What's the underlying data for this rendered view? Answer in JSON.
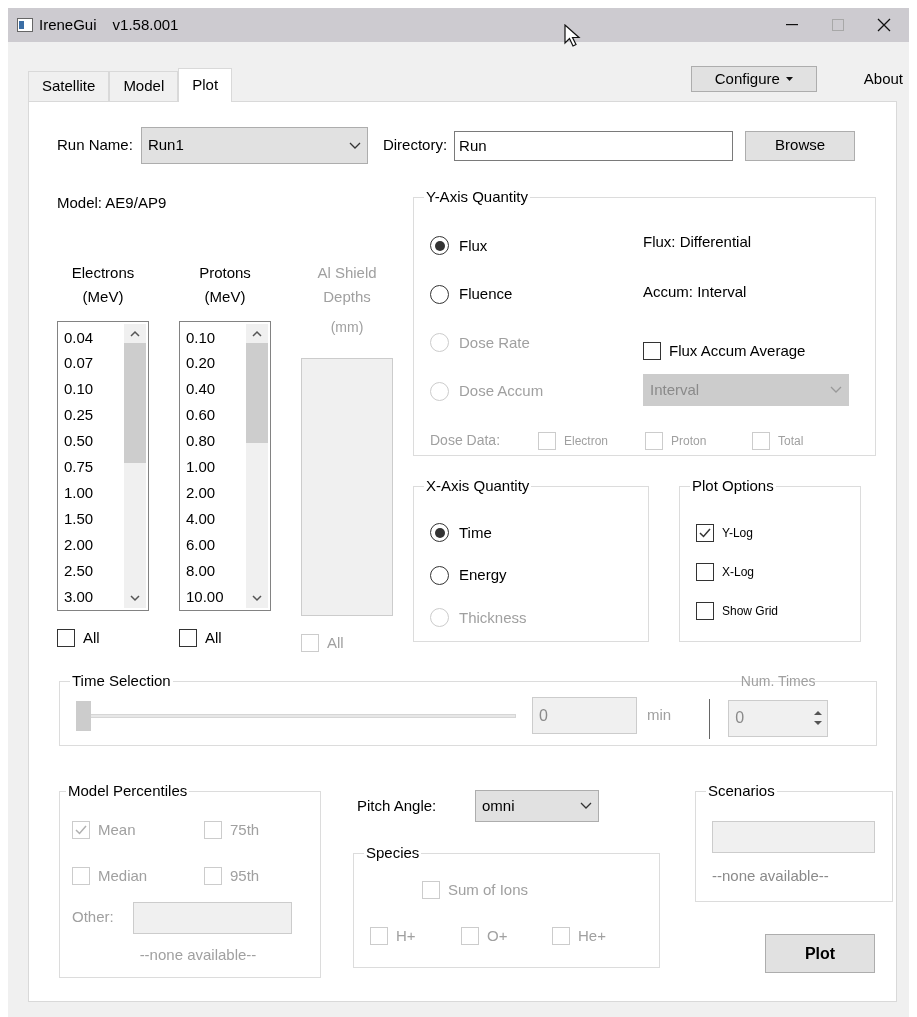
{
  "window": {
    "title": "IreneGui",
    "version": "v1.58.001"
  },
  "tabs": [
    {
      "label": "Satellite",
      "selected": false
    },
    {
      "label": "Model",
      "selected": false
    },
    {
      "label": "Plot",
      "selected": true
    }
  ],
  "toolbar": {
    "configure": "Configure",
    "about": "About"
  },
  "run_name": {
    "label": "Run Name:",
    "value": "Run1"
  },
  "directory": {
    "label": "Directory:",
    "value": "Run"
  },
  "browse": "Browse",
  "model_label": "Model: AE9/AP9",
  "energy_lists": [
    {
      "heading": [
        "Electrons",
        "(MeV)"
      ],
      "disabled": false,
      "items": [
        "0.04",
        "0.07",
        "0.10",
        "0.25",
        "0.50",
        "0.75",
        "1.00",
        "1.50",
        "2.00",
        "2.50",
        "3.00"
      ],
      "all": {
        "label": "All",
        "checked": false
      }
    },
    {
      "heading": [
        "Protons",
        "(MeV)"
      ],
      "disabled": false,
      "items": [
        "0.10",
        "0.20",
        "0.40",
        "0.60",
        "0.80",
        "1.00",
        "2.00",
        "4.00",
        "6.00",
        "8.00",
        "10.00"
      ],
      "all": {
        "label": "All",
        "checked": false
      }
    },
    {
      "heading": [
        "Al Shield",
        "Depths"
      ],
      "unit": "(mm)",
      "disabled": true,
      "all": {
        "label": "All",
        "checked": false
      }
    }
  ],
  "y_axis": {
    "title": "Y-Axis Quantity",
    "options": [
      {
        "label": "Flux",
        "selected": true,
        "disabled": false
      },
      {
        "label": "Fluence",
        "selected": false,
        "disabled": false
      },
      {
        "label": "Dose Rate",
        "selected": false,
        "disabled": true
      },
      {
        "label": "Dose Accum",
        "selected": false,
        "disabled": true
      }
    ],
    "flux_info": "Flux: Differential",
    "accum_info": "Accum: Interval",
    "average": {
      "label": "Flux Accum Average",
      "checked": false
    },
    "average_select": {
      "value": "Interval",
      "disabled": true
    },
    "dose_data": {
      "label": "Dose Data:",
      "disabled": true,
      "items": [
        {
          "label": "Electron",
          "checked": false
        },
        {
          "label": "Proton",
          "checked": false
        },
        {
          "label": "Total",
          "checked": false
        }
      ]
    }
  },
  "x_axis": {
    "title": "X-Axis Quantity",
    "options": [
      {
        "label": "Time",
        "selected": true,
        "disabled": false
      },
      {
        "label": "Energy",
        "selected": false,
        "disabled": false
      },
      {
        "label": "Thickness",
        "selected": false,
        "disabled": true
      }
    ]
  },
  "plot_options": {
    "title": "Plot Options",
    "items": [
      {
        "label": "Y-Log",
        "checked": true
      },
      {
        "label": "X-Log",
        "checked": false
      },
      {
        "label": "Show Grid",
        "checked": false
      }
    ]
  },
  "time_selection": {
    "title": "Time Selection",
    "disabled": true,
    "level": 0,
    "value": "0",
    "unit": "min",
    "num_times_label": "Num. Times",
    "num_times": "0"
  },
  "model_percentiles": {
    "title": "Model Percentiles",
    "disabled": true,
    "options": [
      {
        "label": "Mean",
        "checked": true
      },
      {
        "label": "75th",
        "checked": false
      },
      {
        "label": "Median",
        "checked": false
      },
      {
        "label": "95th",
        "checked": false
      }
    ],
    "other_label": "Other:",
    "note": "--none available--"
  },
  "pitch_angle": {
    "label": "Pitch Angle:",
    "value": "omni"
  },
  "species": {
    "title": "Species",
    "disabled": true,
    "sum": {
      "label": "Sum of Ions",
      "checked": false
    },
    "items": [
      {
        "label": "H+",
        "checked": false
      },
      {
        "label": "O+",
        "checked": false
      },
      {
        "label": "He+",
        "checked": false
      }
    ]
  },
  "scenarios": {
    "title": "Scenarios",
    "note": "--none available--"
  },
  "plot_button": "Plot"
}
